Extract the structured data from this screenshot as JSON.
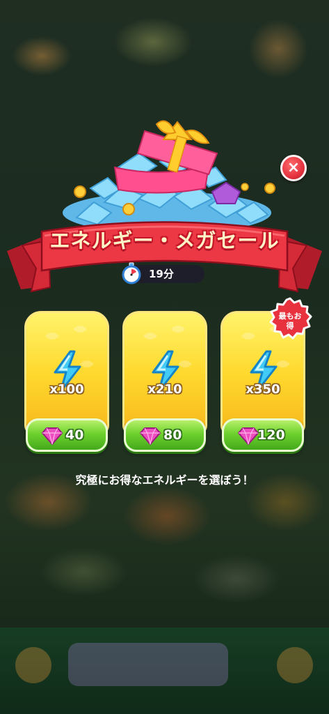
{
  "popup": {
    "title": "エネルギー・メガセール",
    "timer_text": "19分",
    "footer": "究極にお得なエネルギーを選ぼう！",
    "close_icon": "×"
  },
  "offers": [
    {
      "quantity": "x100",
      "price": "40"
    },
    {
      "quantity": "x210",
      "price": "80"
    },
    {
      "quantity": "x350",
      "price": "120",
      "badge": "最もお得"
    }
  ],
  "badge_lines": [
    "最もお",
    "得"
  ],
  "icons": {
    "energy": "lightning-bolt-icon",
    "currency": "gem-icon",
    "timer": "stopwatch-icon",
    "close": "close-icon"
  },
  "colors": {
    "ribbon": "#e8323e",
    "card": "#ffd92e",
    "button": "#6fd12e",
    "gem": "#e33fb5",
    "bolt": "#37c9f0"
  }
}
